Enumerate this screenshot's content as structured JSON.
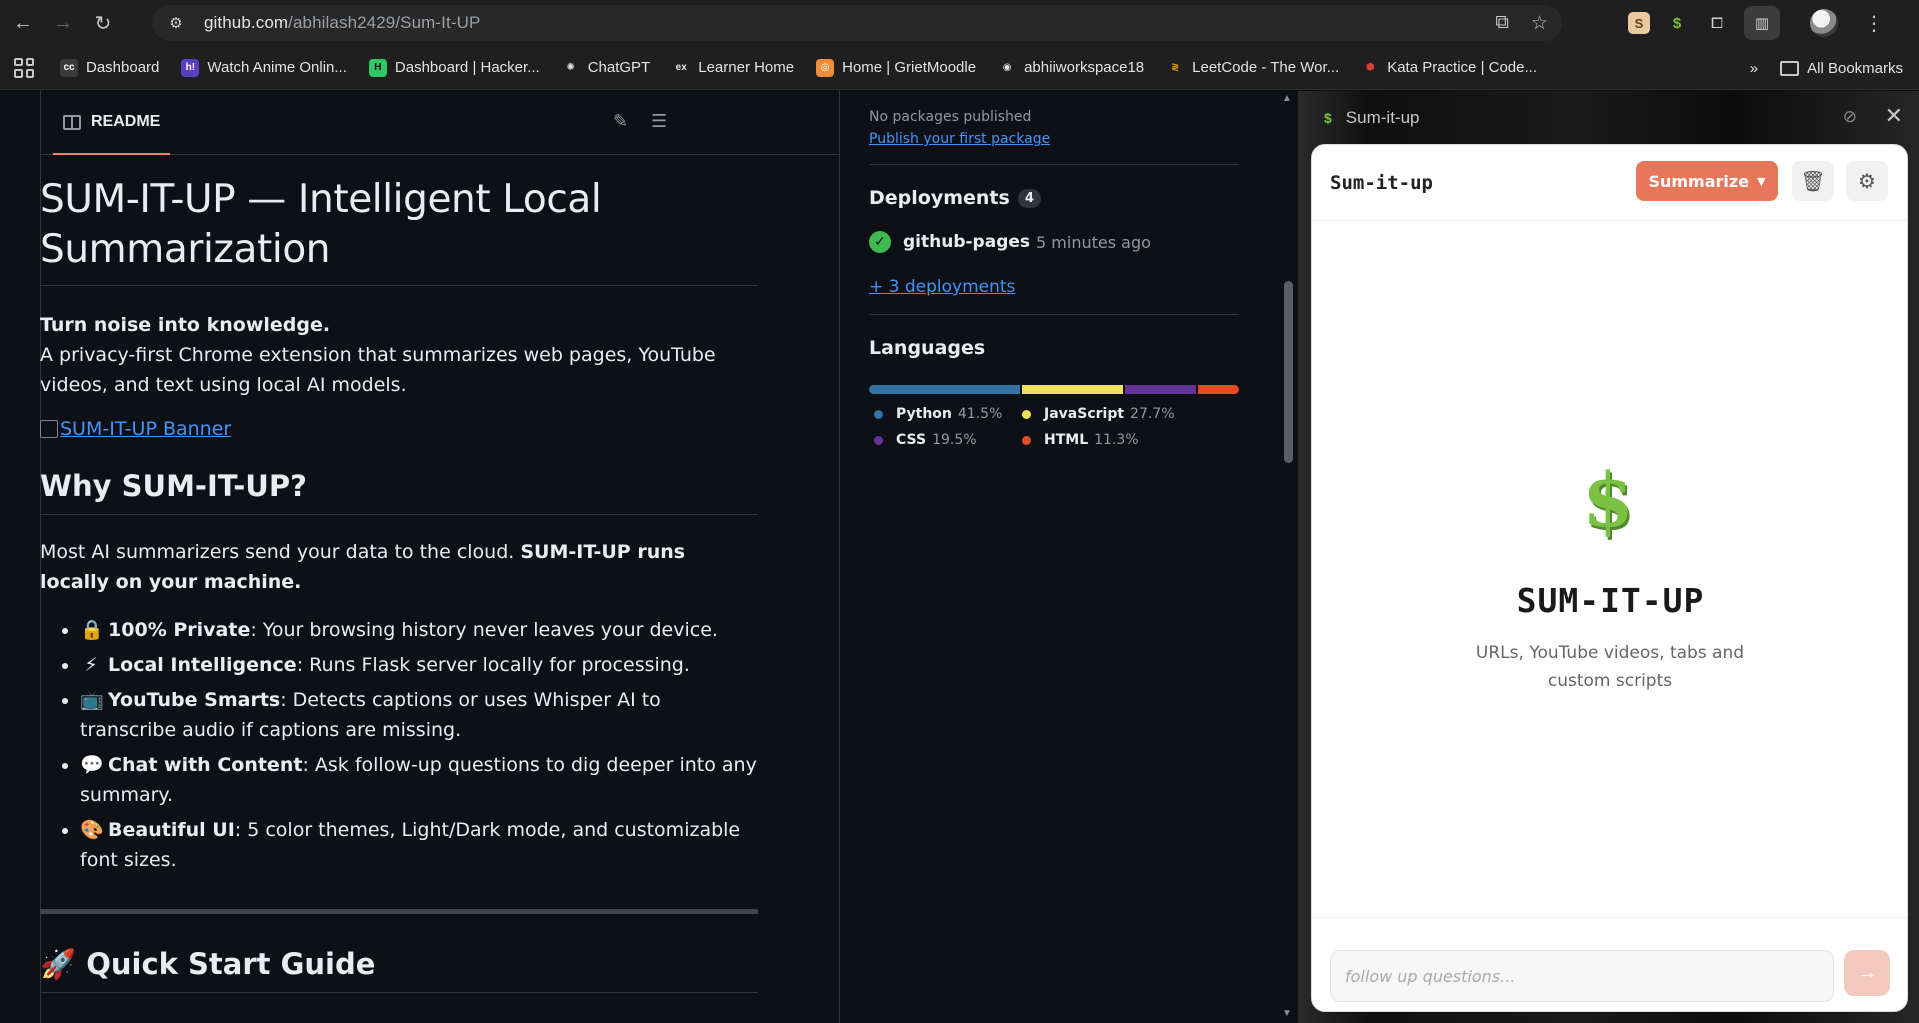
{
  "browser": {
    "url_host": "github.com",
    "url_path": "/abhilash2429/Sum-It-UP",
    "bookmarks": [
      {
        "label": "Dashboard",
        "fav": "cc",
        "color": "#3b3b3b",
        "fg": "#ffffff"
      },
      {
        "label": "Watch Anime Onlin...",
        "fav": "h!",
        "color": "#5b3fbf",
        "fg": "#ffffff"
      },
      {
        "label": "Dashboard | Hacker...",
        "fav": "H",
        "color": "#2ec866",
        "fg": "#0a0a0a"
      },
      {
        "label": "ChatGPT",
        "fav": "✺",
        "color": "transparent",
        "fg": "#e3e3e3"
      },
      {
        "label": "Learner Home",
        "fav": "ex",
        "color": "transparent",
        "fg": "#e3e3e3"
      },
      {
        "label": "Home | GrietMoodle",
        "fav": "◎",
        "color": "#f28c38",
        "fg": "#ffffff"
      },
      {
        "label": "abhiiworkspace18",
        "fav": "◉",
        "color": "transparent",
        "fg": "#e3e3e3"
      },
      {
        "label": "LeetCode - The Wor...",
        "fav": "≷",
        "color": "transparent",
        "fg": "#f0a500"
      },
      {
        "label": "Kata Practice | Code...",
        "fav": "⬢",
        "color": "transparent",
        "fg": "#d43f3a"
      }
    ],
    "all_bookmarks": "All Bookmarks",
    "overflow": "»"
  },
  "readme": {
    "tab_label": "README",
    "title": "SUM-IT-UP — Intelligent Local Summarization",
    "tagline": "Turn noise into knowledge.",
    "description": "A privacy-first Chrome extension that summarizes web pages, YouTube videos, and text using local AI models.",
    "banner_alt": "SUM-IT-UP Banner",
    "why_heading": "Why SUM-IT-UP?",
    "why_text": "Most AI summarizers send your data to the cloud. ",
    "why_bold": "SUM-IT-UP runs locally on your machine.",
    "features": [
      {
        "emoji": "🔒",
        "bold": "100% Private",
        "text": ": Your browsing history never leaves your device."
      },
      {
        "emoji": "⚡",
        "bold": "Local Intelligence",
        "text": ": Runs Flask server locally for processing."
      },
      {
        "emoji": "📺",
        "bold": "YouTube Smarts",
        "text": ": Detects captions or uses Whisper AI to transcribe audio if captions are missing."
      },
      {
        "emoji": "💬",
        "bold": "Chat with Content",
        "text": ": Ask follow-up questions to dig deeper into any summary."
      },
      {
        "emoji": "🎨",
        "bold": "Beautiful UI",
        "text": ": 5 color themes, Light/Dark mode, and customizable font sizes."
      }
    ],
    "quickstart_emoji": "🚀",
    "quickstart_heading": "Quick Start Guide"
  },
  "sidebar": {
    "packages_text": "No packages published",
    "publish_link": "Publish your first package",
    "deployments_title": "Deployments",
    "deployments_count": "4",
    "deploy_name": "github-pages",
    "deploy_time": "5 minutes ago",
    "more_deployments": "+ 3 deployments",
    "languages_title": "Languages",
    "languages": [
      {
        "name": "Python",
        "pct": "41.5%",
        "value": 41.5,
        "color": "#3572a5"
      },
      {
        "name": "JavaScript",
        "pct": "27.7%",
        "value": 27.7,
        "color": "#f1e05a"
      },
      {
        "name": "CSS",
        "pct": "19.5%",
        "value": 19.5,
        "color": "#663399"
      },
      {
        "name": "HTML",
        "pct": "11.3%",
        "value": 11.3,
        "color": "#e34c26"
      }
    ]
  },
  "panel": {
    "header_title": "Sum-it-up",
    "card_title": "Sum-it-up",
    "summarize_label": "Summarize",
    "hero_title": "SUM-IT-UP",
    "hero_subtitle": "URLs, YouTube videos, tabs and custom scripts",
    "followup_placeholder": "follow up questions...",
    "accent": "#e6775b"
  }
}
